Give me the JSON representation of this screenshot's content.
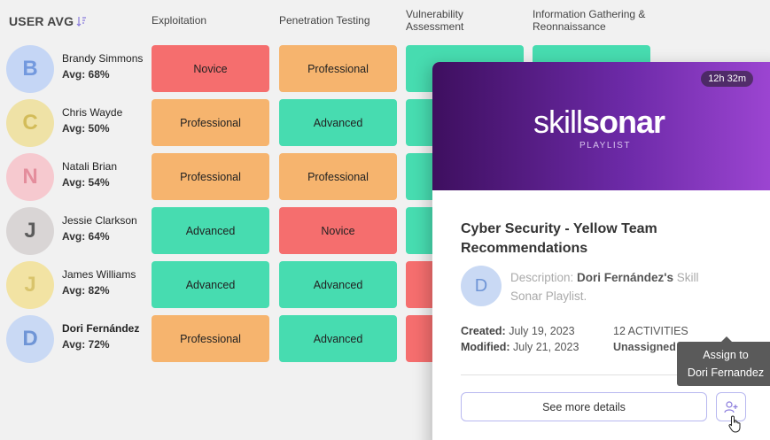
{
  "header": {
    "user_avg": "USER AVG",
    "columns": [
      "Exploitation",
      "Penetration Testing",
      "Vulnerability Assessment",
      "Information Gathering & Reonnaissance"
    ]
  },
  "levels": {
    "novice": "Novice",
    "professional": "Professional",
    "advanced": "Advanced"
  },
  "users": [
    {
      "initial": "B",
      "name": "Brandy Simmons",
      "avg": "Avg: 68%",
      "avatar_bg": "#c5d6f5",
      "avatar_fg": "#7399de",
      "bold_name": false
    },
    {
      "initial": "C",
      "name": "Chris Wayde",
      "avg": "Avg: 50%",
      "avatar_bg": "#efe2a6",
      "avatar_fg": "#d3bc59",
      "bold_name": false
    },
    {
      "initial": "N",
      "name": "Natali Brian",
      "avg": "Avg: 54%",
      "avatar_bg": "#f6c9cf",
      "avatar_fg": "#e48d9c",
      "bold_name": false
    },
    {
      "initial": "J",
      "name": "Jessie Clarkson",
      "avg": "Avg: 64%",
      "avatar_bg": "#d9d5d5",
      "avatar_fg": "#5c5c5c",
      "bold_name": false
    },
    {
      "initial": "J",
      "name": "James Williams",
      "avg": "Avg: 82%",
      "avatar_bg": "#f2e3a3",
      "avatar_fg": "#d9c46c",
      "bold_name": false
    },
    {
      "initial": "D",
      "name": "Dori Fernández",
      "avg": "Avg: 72%",
      "avatar_bg": "#c9d9f4",
      "avatar_fg": "#6f95d6",
      "bold_name": true
    }
  ],
  "grid": [
    {
      "exploitation": "Novice",
      "penetration": "Professional"
    },
    {
      "exploitation": "Professional",
      "penetration": "Advanced"
    },
    {
      "exploitation": "Professional",
      "penetration": "Professional"
    },
    {
      "exploitation": "Advanced",
      "penetration": "Novice"
    },
    {
      "exploitation": "Advanced",
      "penetration": "Advanced"
    },
    {
      "exploitation": "Professional",
      "penetration": "Advanced"
    }
  ],
  "partial_cells": [
    "#47dcb0",
    "#47dcb0",
    "#47dcb0",
    "#47dcb0",
    "#f56e6e",
    "#f56e6e"
  ],
  "card": {
    "duration": "12h 32m",
    "logo_light": "skill",
    "logo_bold": "sonar",
    "logo_sub": "PLAYLIST",
    "title": "Cyber Security - Yellow Team Recommendations",
    "author_initial": "D",
    "desc_label": "Description:",
    "desc_author": "Dori Fernández's",
    "desc_rest": " Skill Sonar Playlist.",
    "created_label": "Created:",
    "created_value": "July 19, 2023",
    "modified_label": "Modified:",
    "modified_value": "July 21, 2023",
    "activities": "12 ACTIVITIES",
    "status": "Unassigned",
    "details_button": "See more details",
    "tooltip_line1": "Assign to",
    "tooltip_line2": "Dori Fernandez"
  },
  "colors": {
    "novice": "#f56e6e",
    "professional": "#f6b46e",
    "advanced": "#47dcb0",
    "accent": "#b8b8f0"
  }
}
